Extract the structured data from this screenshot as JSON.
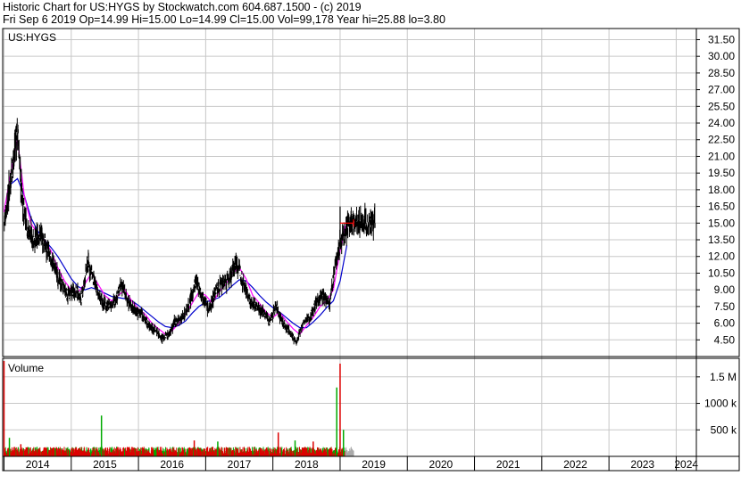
{
  "header": {
    "line1": "Historic Chart for US:HYGS by Stockwatch.com 604.687.1500 - (c) 2019",
    "line2": "Fri Sep  6 2019  Op=14.99  Hi=15.00  Lo=14.99  Cl=15.00  Vol=99,178  Year hi=25.88  lo=3.80"
  },
  "colors": {
    "background": "#ffffff",
    "grid": "#c8c8c8",
    "border": "#000000",
    "price_bars": "#000000",
    "ma_short": "#ff00ff",
    "ma_long": "#0000cc",
    "volume_up": "#00aa00",
    "volume_down": "#dd0000",
    "volume_recent": "#aaaaaa",
    "last_price_marker": "#ff0000"
  },
  "chart_data": [
    {
      "type": "line",
      "title": "US:HYGS",
      "ylabel": "",
      "ylim": [
        3.0,
        32.5
      ],
      "y_ticks": [
        4.5,
        6.0,
        7.5,
        9.0,
        10.5,
        12.0,
        13.5,
        15.0,
        16.5,
        18.0,
        19.5,
        21.0,
        22.5,
        24.0,
        25.5,
        27.0,
        28.5,
        30.0,
        31.5
      ],
      "y_tick_labels": [
        "4.50",
        "6.00",
        "7.50",
        "9.00",
        "10.50",
        "12.00",
        "13.50",
        "15.00",
        "16.50",
        "18.00",
        "19.50",
        "21.00",
        "22.50",
        "24.00",
        "25.50",
        "27.00",
        "28.50",
        "30.00",
        "31.50"
      ],
      "x_ticks": [
        "2014",
        "2015",
        "2016",
        "2017",
        "2018",
        "2019",
        "2020",
        "2021",
        "2022",
        "2023",
        "2024"
      ],
      "xlim": [
        2013.98,
        2024.3
      ],
      "grid": true,
      "series": [
        {
          "kind": "price",
          "x": [
            2014.0,
            2014.1,
            2014.2,
            2014.27,
            2014.35,
            2014.45,
            2014.55,
            2014.65,
            2014.75,
            2014.85,
            2014.95,
            2015.05,
            2015.15,
            2015.25,
            2015.35,
            2015.45,
            2015.55,
            2015.65,
            2015.75,
            2015.85,
            2015.95,
            2016.05,
            2016.15,
            2016.25,
            2016.35,
            2016.45,
            2016.55,
            2016.65,
            2016.75,
            2016.85,
            2016.95,
            2017.05,
            2017.15,
            2017.25,
            2017.35,
            2017.45,
            2017.55,
            2017.65,
            2017.75,
            2017.85,
            2017.95,
            2018.05,
            2018.15,
            2018.25,
            2018.35,
            2018.45,
            2018.55,
            2018.65,
            2018.75,
            2018.85,
            2018.95,
            2019.05,
            2019.15,
            2019.25,
            2019.35,
            2019.45,
            2019.5,
            2019.55,
            2019.6,
            2019.68
          ],
          "values": [
            15.0,
            19.0,
            23.5,
            17.0,
            14.5,
            13.5,
            14.0,
            12.5,
            11.0,
            9.5,
            8.5,
            9.0,
            8.2,
            11.5,
            9.5,
            8.0,
            7.5,
            8.0,
            9.5,
            7.8,
            7.2,
            6.8,
            5.8,
            5.5,
            4.6,
            5.0,
            6.2,
            6.5,
            7.5,
            9.8,
            8.5,
            7.2,
            9.0,
            9.5,
            10.0,
            11.5,
            10.0,
            8.0,
            7.5,
            7.0,
            6.2,
            7.5,
            6.0,
            5.2,
            4.2,
            6.0,
            6.5,
            8.0,
            8.5,
            8.0,
            12.0,
            14.0,
            15.0,
            15.0,
            15.0,
            15.0,
            15.0,
            15.0,
            15.0,
            15.0
          ]
        },
        {
          "kind": "ma_short",
          "x": [
            2014.0,
            2014.1,
            2014.2,
            2014.3,
            2014.4,
            2014.5,
            2014.6,
            2014.7,
            2014.8,
            2014.9,
            2015.0,
            2015.1,
            2015.2,
            2015.3,
            2015.4,
            2015.5,
            2015.6,
            2015.7,
            2015.8,
            2015.9,
            2016.0,
            2016.1,
            2016.2,
            2016.3,
            2016.4,
            2016.5,
            2016.6,
            2016.7,
            2016.8,
            2016.9,
            2017.0,
            2017.1,
            2017.2,
            2017.3,
            2017.4,
            2017.5,
            2017.6,
            2017.7,
            2017.8,
            2017.9,
            2018.0,
            2018.1,
            2018.2,
            2018.3,
            2018.4,
            2018.5,
            2018.6,
            2018.7,
            2018.8,
            2018.9,
            2019.0,
            2019.08
          ],
          "values": [
            16.0,
            19.5,
            22.5,
            17.5,
            15.0,
            14.0,
            13.5,
            12.5,
            11.0,
            9.8,
            9.0,
            8.8,
            9.5,
            10.5,
            9.5,
            8.5,
            8.0,
            8.5,
            9.0,
            8.0,
            7.3,
            6.8,
            6.0,
            5.5,
            5.0,
            5.3,
            6.0,
            6.8,
            7.8,
            8.8,
            8.5,
            7.8,
            8.8,
            9.5,
            10.5,
            11.0,
            10.0,
            8.5,
            7.8,
            7.0,
            6.5,
            7.0,
            6.2,
            5.5,
            5.0,
            5.8,
            6.5,
            7.5,
            8.0,
            9.0,
            12.5,
            14.8
          ]
        },
        {
          "kind": "ma_long",
          "x": [
            2014.1,
            2014.2,
            2014.3,
            2014.4,
            2014.5,
            2014.6,
            2014.7,
            2014.8,
            2014.9,
            2015.0,
            2015.1,
            2015.2,
            2015.3,
            2015.4,
            2015.5,
            2015.6,
            2015.7,
            2015.8,
            2015.9,
            2016.0,
            2016.1,
            2016.2,
            2016.3,
            2016.4,
            2016.5,
            2016.6,
            2016.7,
            2016.8,
            2016.9,
            2017.0,
            2017.1,
            2017.2,
            2017.3,
            2017.4,
            2017.5,
            2017.6,
            2017.7,
            2017.8,
            2017.9,
            2018.0,
            2018.1,
            2018.2,
            2018.3,
            2018.4,
            2018.5,
            2018.6,
            2018.7,
            2018.8,
            2018.9,
            2019.0,
            2019.1
          ],
          "values": [
            18.5,
            19.0,
            17.5,
            15.5,
            14.3,
            13.5,
            12.8,
            12.0,
            11.0,
            10.0,
            9.3,
            9.0,
            9.2,
            9.0,
            8.7,
            8.4,
            8.3,
            8.2,
            8.0,
            7.6,
            7.1,
            6.6,
            6.1,
            5.7,
            5.6,
            5.8,
            6.2,
            6.9,
            7.5,
            7.9,
            8.1,
            8.3,
            8.8,
            9.4,
            9.9,
            9.8,
            9.2,
            8.5,
            7.9,
            7.4,
            7.0,
            6.5,
            6.0,
            5.6,
            5.6,
            6.1,
            6.7,
            7.4,
            8.0,
            9.8,
            13.0
          ]
        }
      ]
    },
    {
      "type": "bar",
      "title": "Volume",
      "y_ticks": [
        500000,
        1000000,
        1500000
      ],
      "y_tick_labels": [
        "500 k",
        "1000 k",
        "1.5 M"
      ],
      "ylim": [
        0,
        1850000
      ],
      "x_ticks": [
        "2014",
        "2015",
        "2016",
        "2017",
        "2018",
        "2019",
        "2020",
        "2021",
        "2022",
        "2023",
        "2024"
      ],
      "spikes": {
        "x": [
          2014.0,
          2014.08,
          2014.25,
          2015.45,
          2016.83,
          2017.18,
          2018.08,
          2018.33,
          2018.6,
          2018.95,
          2019.0,
          2019.05
        ],
        "values": [
          1800000,
          350000,
          230000,
          770000,
          300000,
          280000,
          450000,
          300000,
          280000,
          1300000,
          1750000,
          500000
        ]
      },
      "baseline_typical": 150000
    }
  ]
}
